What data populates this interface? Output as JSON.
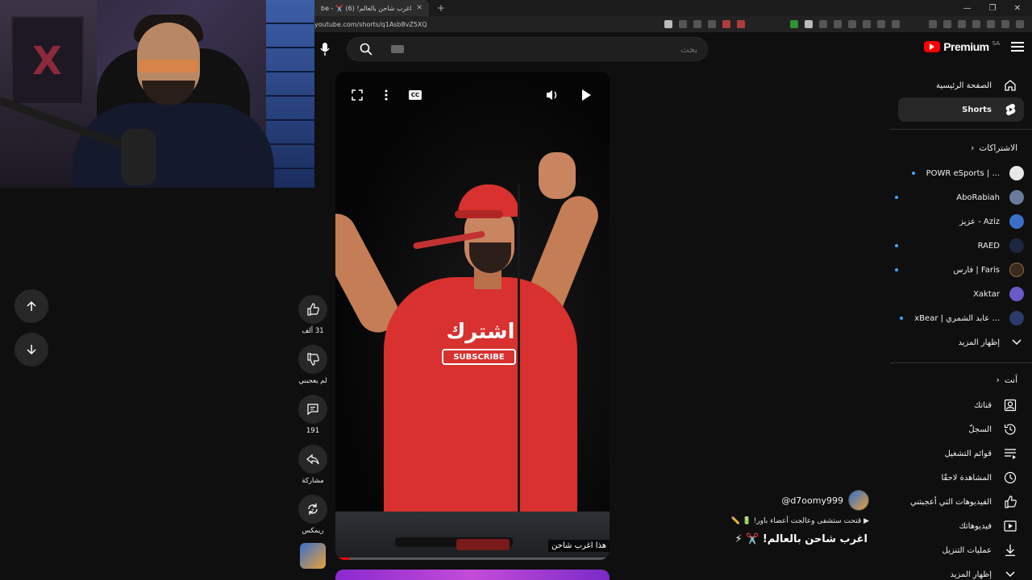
{
  "browser": {
    "tab_title": "(6) اغرب شاحن بالعالم! ✂️ - ...",
    "tab_title_short": "be - ✂️ اغرب شاحن بالعالم! (6)",
    "url": "youtube.com/shorts/q1Asb8vZ5XQ"
  },
  "search": {
    "placeholder": "بحث"
  },
  "video": {
    "shirt_text": "اشترك",
    "shirt_sub": "SUBSCRIBE",
    "cap_text": "اشترك",
    "caption": "هذا اغرب شاحن",
    "cc_label": "CC",
    "progress_fraction": 0.05
  },
  "actions": {
    "like_count": "31 ألف",
    "dislike_label": "لم يعجبني",
    "comments_count": "191",
    "share_label": "مشاركة",
    "remix_label": "ريمكس"
  },
  "channel": {
    "handle": "@d7oomy999",
    "description": "قتحت ستشفى وعالجت أعضاء باور! 🔋 ✏️",
    "title": "اغرب شاحن بالعالم! ✂️ ⚡"
  },
  "sidebar": {
    "brand": "Premium",
    "region": "SA",
    "nav": [
      {
        "label": "الصفحة الرئيسية",
        "icon": "home-icon"
      },
      {
        "label": "Shorts",
        "icon": "shorts-icon"
      }
    ],
    "subscriptions_title": "الاشتراكات",
    "subscriptions": [
      {
        "name": "POWR eSports | ...",
        "live": true,
        "color": "#e8e8e8"
      },
      {
        "name": "AboRabiah",
        "live": true,
        "color": "#6a7a9a"
      },
      {
        "name": "عزيز - Aziz",
        "live": false,
        "color": "#3a6fc8"
      },
      {
        "name": "RAED",
        "live": true,
        "color": "#1d2740"
      },
      {
        "name": "فارس | Faris",
        "live": true,
        "color": "#3a2a1a"
      },
      {
        "name": "Xaktar",
        "live": false,
        "color": "#6a5ac8"
      },
      {
        "name": "xBear | عابد الشمري ...",
        "live": true,
        "color": "#2a3a6a"
      }
    ],
    "show_more": "إظهار المزيد",
    "you_title": "أنت",
    "you_items": [
      {
        "label": "قناتك",
        "icon": "user-icon"
      },
      {
        "label": "السجلّ",
        "icon": "history-icon"
      },
      {
        "label": "قوائم التشغيل",
        "icon": "playlist-icon"
      },
      {
        "label": "المشاهدة لاحقًا",
        "icon": "clock-icon"
      },
      {
        "label": "الفيديوهات التي أعجبتني",
        "icon": "like-icon"
      },
      {
        "label": "فيديوهاتك",
        "icon": "video-icon"
      },
      {
        "label": "عمليات التنزيل",
        "icon": "download-icon"
      }
    ],
    "show_more_2": "إظهار المزيد"
  }
}
